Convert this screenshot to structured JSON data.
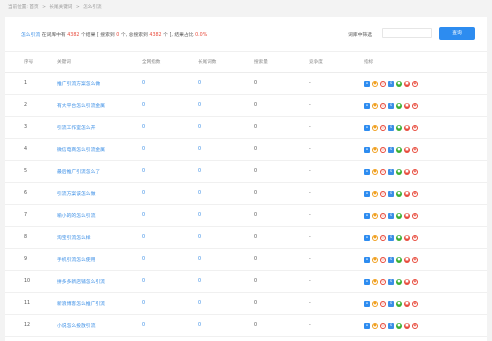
{
  "breadcrumb": {
    "prefix": "当前位置:",
    "items": [
      "首页",
      "长尾关键词",
      "怎么引流"
    ],
    "separator": ">"
  },
  "summary": {
    "keyword": "怎么引流",
    "text_a": " 在词库中有 ",
    "total": "4382",
    "text_b": " 个结果 [ 搜索到 ",
    "found": "0",
    "text_c": " 个, 总搜索到 ",
    "all_found": "4382",
    "text_d": " 个 ], 结果占比 ",
    "ratio": "0.0%"
  },
  "filter": {
    "label": "词库中筛选",
    "value": "",
    "placeholder": "",
    "button_label": "查询"
  },
  "table": {
    "headers": [
      "序号",
      "关键词",
      "全网指数",
      "长尾词数",
      "搜索量",
      "竞争度",
      "指标"
    ],
    "rows": [
      {
        "idx": "1",
        "kw": "推广引流方案怎么做",
        "a": "0",
        "b": "0",
        "c": "0",
        "d": "-"
      },
      {
        "idx": "2",
        "kw": "有大平台怎么引流金属",
        "a": "0",
        "b": "0",
        "c": "0",
        "d": "-"
      },
      {
        "idx": "3",
        "kw": "引流工作室怎么开",
        "a": "0",
        "b": "0",
        "c": "0",
        "d": "-"
      },
      {
        "idx": "4",
        "kw": "微信电商怎么引流金属",
        "a": "0",
        "b": "0",
        "c": "0",
        "d": "-"
      },
      {
        "idx": "5",
        "kw": "最后推广引流怎么了",
        "a": "0",
        "b": "0",
        "c": "0",
        "d": "-"
      },
      {
        "idx": "6",
        "kw": "引流方案该怎么做",
        "a": "0",
        "b": "0",
        "c": "0",
        "d": "-"
      },
      {
        "idx": "7",
        "kw": "喻小的的怎么引流",
        "a": "0",
        "b": "0",
        "c": "0",
        "d": "-"
      },
      {
        "idx": "8",
        "kw": "淘宝引流怎么样",
        "a": "0",
        "b": "0",
        "c": "0",
        "d": "-"
      },
      {
        "idx": "9",
        "kw": "手机引流怎么使用",
        "a": "0",
        "b": "0",
        "c": "0",
        "d": "-"
      },
      {
        "idx": "10",
        "kw": "拼多多新店铺怎么引流",
        "a": "0",
        "b": "0",
        "c": "0",
        "d": "-"
      },
      {
        "idx": "11",
        "kw": "新浪博客怎么推广引流",
        "a": "0",
        "b": "0",
        "c": "0",
        "d": "-"
      },
      {
        "idx": "12",
        "kw": "小说怎么投放引流",
        "a": "0",
        "b": "0",
        "c": "0",
        "d": "-"
      }
    ]
  },
  "op_icons": [
    {
      "name": "home-icon",
      "glyph": "⌂",
      "cls": "home"
    },
    {
      "name": "baidu-icon",
      "glyph": "●",
      "cls": "bar"
    },
    {
      "name": "360-icon",
      "glyph": "◎",
      "cls": "ring"
    },
    {
      "name": "sogou-icon",
      "glyph": "S",
      "cls": "sogou"
    },
    {
      "name": "wechat-icon",
      "glyph": "●",
      "cls": "wechat"
    },
    {
      "name": "stop-icon",
      "glyph": "■",
      "cls": "stop"
    },
    {
      "name": "weibo-icon",
      "glyph": "◉",
      "cls": "weibo"
    }
  ],
  "colors": {
    "link": "#3a8ee6",
    "highlight": "#e84c3d",
    "button": "#2d8cf0"
  }
}
